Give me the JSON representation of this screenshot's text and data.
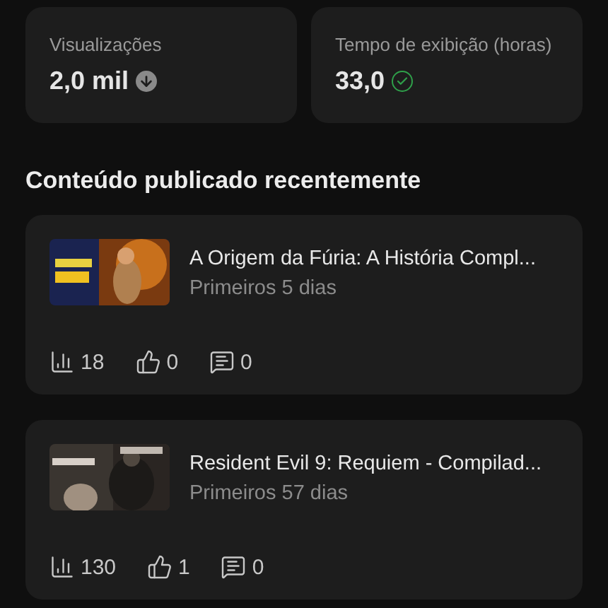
{
  "metrics": [
    {
      "label": "Visualizações",
      "value": "2,0 mil",
      "kind": "down"
    },
    {
      "label": "Tempo de exibição (horas)",
      "value": "33,0",
      "kind": "ok"
    }
  ],
  "section_title": "Conteúdo publicado recentemente",
  "videos": [
    {
      "title": "A Origem da Fúria: A História Compl...",
      "period": "Primeiros 5 dias",
      "views": "18",
      "likes": "0",
      "comments": "0"
    },
    {
      "title": "Resident Evil 9: Requiem - Compilad...",
      "period": "Primeiros 57 dias",
      "views": "130",
      "likes": "1",
      "comments": "0"
    }
  ]
}
